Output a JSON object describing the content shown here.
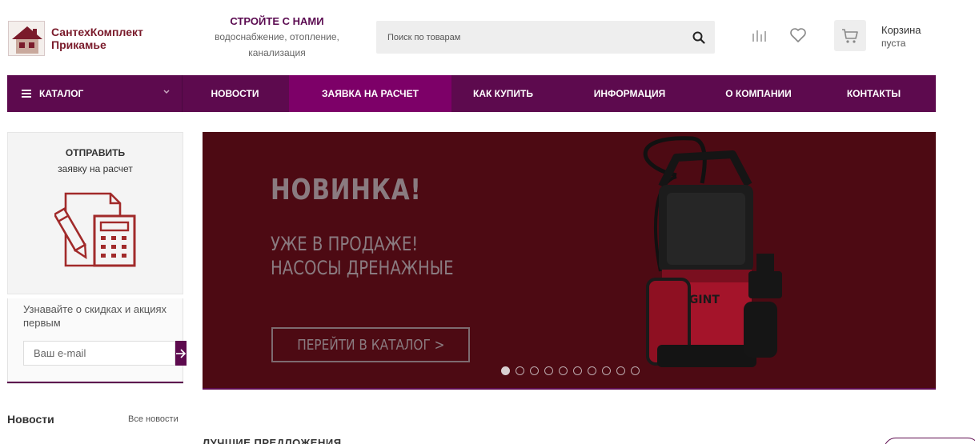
{
  "header": {
    "logo_text_line1": "СантехКомплект",
    "logo_text_line2": "Прикамье",
    "tagline_title": "СТРОЙТЕ С НАМИ",
    "tagline_line1": "водоснабжение, отопление,",
    "tagline_line2": "канализация",
    "search_placeholder": "Поиск по товарам",
    "cart_title": "Корзина",
    "cart_status": "пуста"
  },
  "nav": {
    "catalog": "КАТАЛОГ",
    "items": [
      {
        "label": "НОВОСТИ"
      },
      {
        "label": "ЗАЯВКА НА РАСЧЕТ"
      },
      {
        "label": "КАК КУПИТЬ"
      },
      {
        "label": "ИНФОРМАЦИЯ"
      },
      {
        "label": "О КОМПАНИИ"
      },
      {
        "label": "КОНТАКТЫ"
      }
    ]
  },
  "sidebar": {
    "card_title": "ОТПРАВИТЬ",
    "card_subtitle": "заявку на расчет",
    "subscribe_text": "Узнавайте о скидках и акциях первым",
    "email_placeholder": "Ваш e-mail",
    "news_title": "Новости",
    "news_all": "Все новости"
  },
  "banner": {
    "headline": "НОВИНКА!",
    "line1": "УЖЕ В ПРОДАЖЕ!",
    "line2": "НАСОСЫ ДРЕНАЖНЫЕ",
    "button": "ПЕРЕЙТИ В КАТАЛОГ >",
    "pump_brand": "OGINT",
    "slides_total": 10,
    "active_slide": 1
  },
  "main": {
    "best_offers": "ЛУЧШИЕ ПРЕДЛОЖЕНИЯ"
  },
  "colors": {
    "brand_purple": "#5d0a4e",
    "active_nav": "#7d0068",
    "banner_bg": "#4d0a13",
    "logo_red": "#7a1b2b",
    "icon_red": "#a12a2a"
  }
}
